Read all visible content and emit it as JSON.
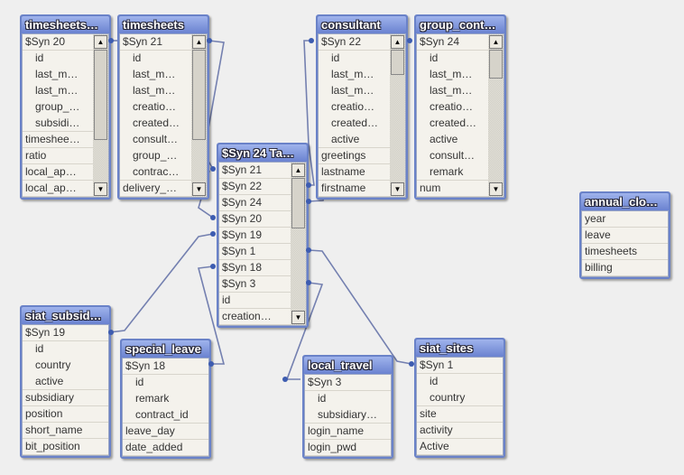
{
  "diagram": {
    "tables": [
      {
        "title": "timesheets…",
        "scroll": true,
        "fields": [
          {
            "name": "$Syn 20"
          },
          {
            "name": "id",
            "sub": true
          },
          {
            "name": "last_m…",
            "sub": true
          },
          {
            "name": "last_m…",
            "sub": true
          },
          {
            "name": "group_…",
            "sub": true
          },
          {
            "name": "subsidi…",
            "sub": true
          },
          {
            "name": "timeshee…"
          },
          {
            "name": "ratio"
          },
          {
            "name": "local_ap…"
          },
          {
            "name": "local_ap…"
          }
        ]
      },
      {
        "title": "timesheets",
        "scroll": true,
        "fields": [
          {
            "name": "$Syn 21"
          },
          {
            "name": "id",
            "sub": true
          },
          {
            "name": "last_m…",
            "sub": true
          },
          {
            "name": "last_m…",
            "sub": true
          },
          {
            "name": "creatio…",
            "sub": true
          },
          {
            "name": "created…",
            "sub": true
          },
          {
            "name": "consult…",
            "sub": true
          },
          {
            "name": "group_…",
            "sub": true
          },
          {
            "name": "contrac…",
            "sub": true
          },
          {
            "name": "delivery_…"
          }
        ]
      },
      {
        "title": "$Syn 24 Ta…",
        "scroll": true,
        "fields": [
          {
            "name": "$Syn 21"
          },
          {
            "name": "$Syn 22"
          },
          {
            "name": "$Syn 24"
          },
          {
            "name": "$Syn 20"
          },
          {
            "name": "$Syn 19"
          },
          {
            "name": "$Syn 1"
          },
          {
            "name": "$Syn 18"
          },
          {
            "name": "$Syn 3"
          },
          {
            "name": "id"
          },
          {
            "name": "creation…"
          }
        ]
      },
      {
        "title": "consultant",
        "scroll": true,
        "fields": [
          {
            "name": "$Syn 22"
          },
          {
            "name": "id",
            "sub": true
          },
          {
            "name": "last_m…",
            "sub": true
          },
          {
            "name": "last_m…",
            "sub": true
          },
          {
            "name": "creatio…",
            "sub": true
          },
          {
            "name": "created…",
            "sub": true
          },
          {
            "name": "active",
            "sub": true
          },
          {
            "name": "greetings"
          },
          {
            "name": "lastname"
          },
          {
            "name": "firstname"
          }
        ]
      },
      {
        "title": "group_cont…",
        "scroll": true,
        "fields": [
          {
            "name": "$Syn 24"
          },
          {
            "name": "id",
            "sub": true
          },
          {
            "name": "last_m…",
            "sub": true
          },
          {
            "name": "last_m…",
            "sub": true
          },
          {
            "name": "creatio…",
            "sub": true
          },
          {
            "name": "created…",
            "sub": true
          },
          {
            "name": "active",
            "sub": true
          },
          {
            "name": "consult…",
            "sub": true
          },
          {
            "name": "remark",
            "sub": true
          },
          {
            "name": "num"
          }
        ]
      },
      {
        "title": "annual_clo…",
        "scroll": false,
        "fields": [
          {
            "name": "year"
          },
          {
            "name": "leave"
          },
          {
            "name": "timesheets"
          },
          {
            "name": "billing"
          }
        ]
      },
      {
        "title": "siat_subsid…",
        "scroll": false,
        "fields": [
          {
            "name": "$Syn 19"
          },
          {
            "name": "id",
            "sub": true
          },
          {
            "name": "country",
            "sub": true
          },
          {
            "name": "active",
            "sub": true
          },
          {
            "name": "subsidiary"
          },
          {
            "name": "position"
          },
          {
            "name": "short_name"
          },
          {
            "name": "bit_position"
          }
        ]
      },
      {
        "title": "special_leave",
        "scroll": false,
        "fields": [
          {
            "name": "$Syn 18"
          },
          {
            "name": "id",
            "sub": true
          },
          {
            "name": "remark",
            "sub": true
          },
          {
            "name": "contract_id",
            "sub": true
          },
          {
            "name": "leave_day"
          },
          {
            "name": "date_added"
          }
        ]
      },
      {
        "title": "local_travel",
        "scroll": false,
        "fields": [
          {
            "name": "$Syn 3"
          },
          {
            "name": "id",
            "sub": true
          },
          {
            "name": "subsidiary…",
            "sub": true
          },
          {
            "name": "login_name"
          },
          {
            "name": "login_pwd"
          }
        ]
      },
      {
        "title": "siat_sites",
        "scroll": false,
        "fields": [
          {
            "name": "$Syn 1"
          },
          {
            "name": "id",
            "sub": true
          },
          {
            "name": "country",
            "sub": true
          },
          {
            "name": "site"
          },
          {
            "name": "activity"
          },
          {
            "name": "Active"
          }
        ]
      }
    ],
    "link_color": "#7480b0",
    "header_color": "#6a82c8"
  }
}
